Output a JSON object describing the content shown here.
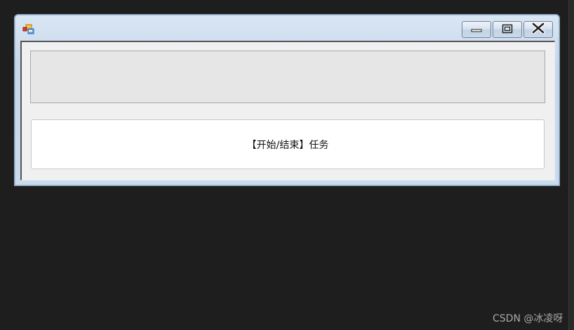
{
  "window": {
    "icon": "application-form-icon",
    "controls": {
      "minimize_icon": "minimize-icon",
      "maximize_icon": "maximize-icon",
      "close_icon": "close-icon"
    }
  },
  "form": {
    "output_textbox_value": "",
    "task_button_label": "【开始/结束】任务"
  },
  "watermark": {
    "text": "CSDN @冰凌呀"
  },
  "colors": {
    "desktop_bg": "#1e1e1e",
    "titlebar_top": "#d9e6f4",
    "client_bg": "#f0f0f0",
    "textbox_bg": "#e6e6e6",
    "button_bg": "#ffffff"
  }
}
